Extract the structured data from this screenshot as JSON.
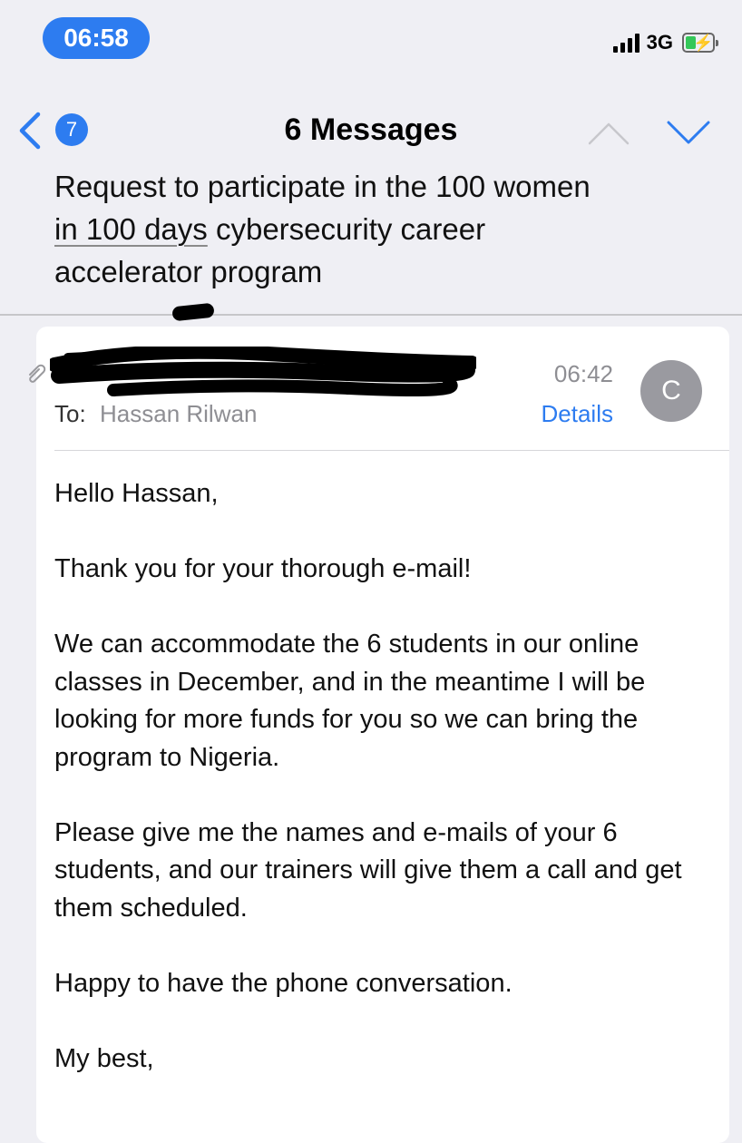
{
  "status_bar": {
    "time": "06:58",
    "network": "3G"
  },
  "nav": {
    "unread_count": "7",
    "title": "6 Messages"
  },
  "subject": {
    "line1": "Request to participate in the 100 women",
    "line2_underlined": "in 100 days",
    "line2_rest": " cybersecurity career",
    "line3": "accelerator program"
  },
  "message": {
    "time": "06:42",
    "to_label": "To:",
    "to_name": "Hassan Rilwan",
    "details_label": "Details",
    "avatar_initial": "C",
    "body": [
      "Hello Hassan,",
      "Thank you for your thorough e-mail!",
      "We can accommodate the 6 students in our online classes in December, and in the meantime I will be looking for more funds for you so we can bring the program to Nigeria.",
      "Please give me the names and e-mails of your 6 students, and our trainers will give them a call and get them scheduled.",
      "Happy to have the phone conversation.",
      "My best,"
    ]
  },
  "colors": {
    "accent": "#2d7cf0",
    "background": "#efeff4",
    "card": "#ffffff",
    "muted": "#8e8e93",
    "avatar": "#9a9aa0",
    "battery": "#34c759"
  }
}
